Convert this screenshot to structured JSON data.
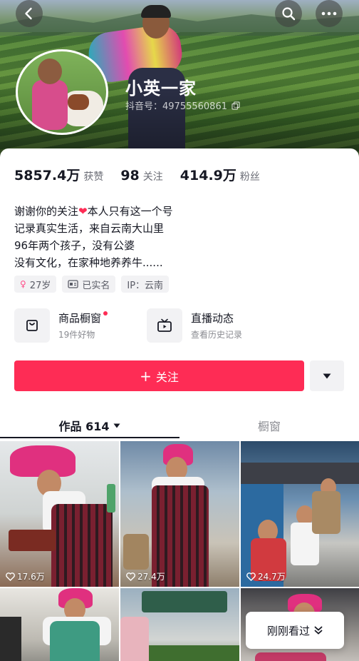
{
  "header": {
    "name": "小英一家",
    "douyin_id": "抖音号：49755560861"
  },
  "stats": [
    {
      "num": "5857.4万",
      "label": "获赞"
    },
    {
      "num": "98",
      "label": "关注"
    },
    {
      "num": "414.9万",
      "label": "粉丝"
    }
  ],
  "bio": {
    "line1_a": "谢谢你的关注",
    "line1_heart": "❤",
    "line1_b": "本人只有这一个号",
    "line2": "记录真实生活，来自云南大山里",
    "line3": "96年两个孩子，没有公婆",
    "line4": "没有文化，在家种地养养牛......"
  },
  "tags": {
    "age": "27岁",
    "verified": "已实名",
    "ip": "IP：云南"
  },
  "shortcuts": {
    "shop_title": "商品橱窗",
    "shop_sub": "19件好物",
    "live_title": "直播动态",
    "live_sub": "查看历史记录"
  },
  "follow_label": "关注",
  "tabs": {
    "works": "作品 614",
    "showcase": "橱窗"
  },
  "videos": [
    {
      "likes": "17.6万"
    },
    {
      "likes": "27.4万"
    },
    {
      "likes": "24.7万"
    }
  ],
  "recent_label": "刚刚看过",
  "colors": {
    "accent": "#fe2c55",
    "text": "#161823",
    "muted": "#8a8b91"
  }
}
